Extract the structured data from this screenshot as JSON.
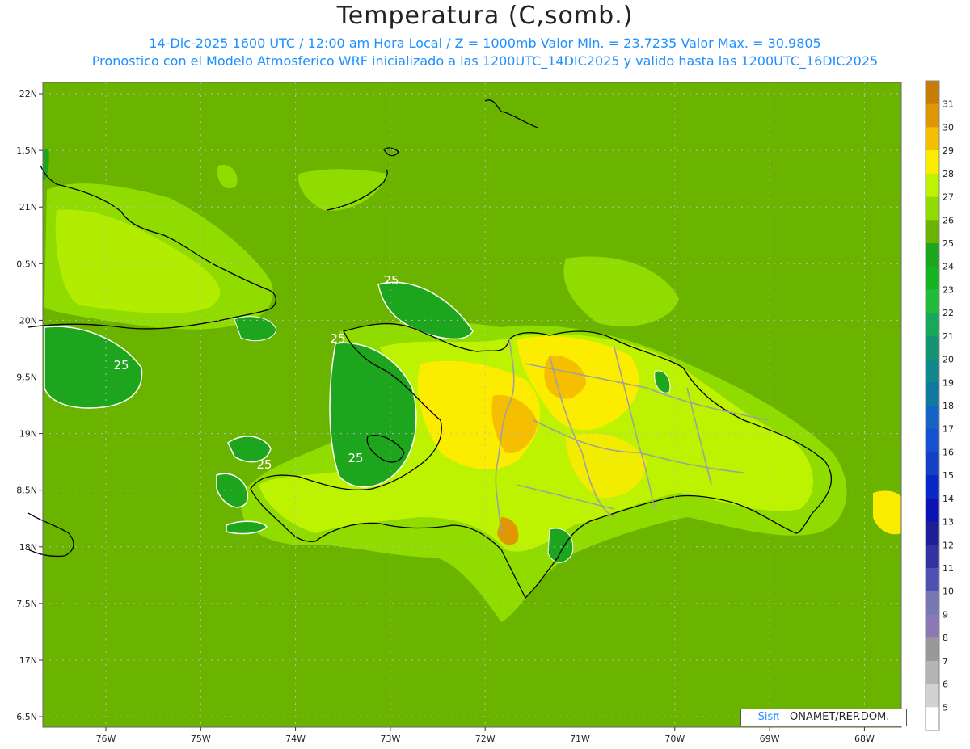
{
  "header": {
    "title": "Temperatura (C,somb.)",
    "subtitle_line1": "14-Dic-2025 1600 UTC / 12:00 am Hora Local / Z = 1000mb  Valor Min. = 23.7235  Valor Max. = 30.9805",
    "subtitle_line2": "Pronostico con el Modelo Atmosferico WRF inicializado a las 1200UTC_14DIC2025 y valido hasta las  1200UTC_16DIC2025"
  },
  "chart_data": {
    "type": "heatmap",
    "variable": "Temperatura",
    "units": "C",
    "level": "1000mb",
    "min_value": 23.7235,
    "max_value": 30.9805,
    "lat_ticks": [
      "22N",
      "1.5N",
      "21N",
      "0.5N",
      "20N",
      "9.5N",
      "19N",
      "8.5N",
      "18N",
      "7.5N",
      "17N",
      "6.5N"
    ],
    "lon_ticks": [
      "76W",
      "75W",
      "74W",
      "73W",
      "72W",
      "71W",
      "70W",
      "69W",
      "68W"
    ],
    "contour_labels": [
      "25",
      "25",
      "25",
      "25",
      "25"
    ],
    "colorbar": {
      "labels": [
        "31",
        "30",
        "29",
        "28",
        "27",
        "26",
        "25",
        "24",
        "23",
        "22",
        "21",
        "20",
        "19",
        "18",
        "17",
        "16",
        "15",
        "14",
        "13",
        "12",
        "11",
        "10",
        "9",
        "8",
        "7",
        "6",
        "5"
      ],
      "colors": [
        "#c87d00",
        "#e09600",
        "#f5bf00",
        "#fcec00",
        "#bdf200",
        "#90dc00",
        "#6ab400",
        "#1ea51e",
        "#14b41e",
        "#20bd3c",
        "#18a85a",
        "#149473",
        "#10888c",
        "#0f7aa0",
        "#1464c3",
        "#1450d2",
        "#1440c8",
        "#0a28c8",
        "#0a14b4",
        "#1e1e96",
        "#3232a0",
        "#5050b4",
        "#7878b4",
        "#8c78b4",
        "#999999",
        "#b4b4b4",
        "#d2d2d2",
        "#ffffff"
      ]
    }
  },
  "credit": {
    "sis": "Sis",
    "pi": "π",
    "text": "- ONAMET/REP.DOM."
  }
}
